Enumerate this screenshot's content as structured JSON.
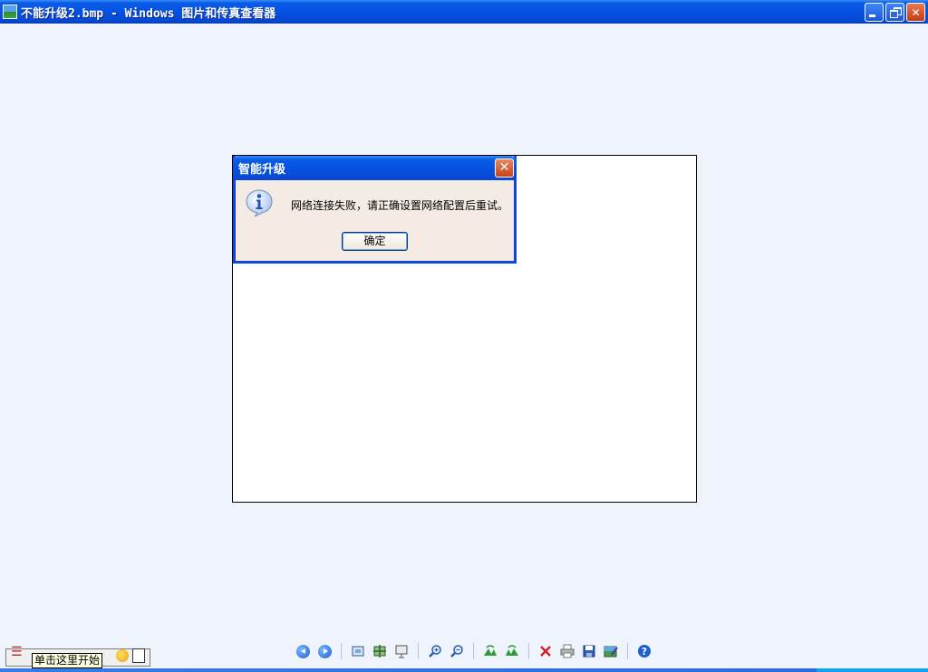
{
  "window": {
    "title": "不能升级2.bmp - Windows 图片和传真查看器"
  },
  "dialog": {
    "title": "智能升级",
    "message": "网络连接失败，请正确设置网络配置后重试。",
    "ok_label": "确定"
  },
  "tooltip": {
    "text": "单击这里开始"
  },
  "toolbar": {
    "buttons": [
      "previous-image",
      "next-image",
      "best-fit",
      "actual-size",
      "slideshow",
      "zoom-in",
      "zoom-out",
      "rotate-clockwise",
      "rotate-counterclockwise",
      "delete",
      "print",
      "save",
      "edit",
      "help"
    ]
  }
}
